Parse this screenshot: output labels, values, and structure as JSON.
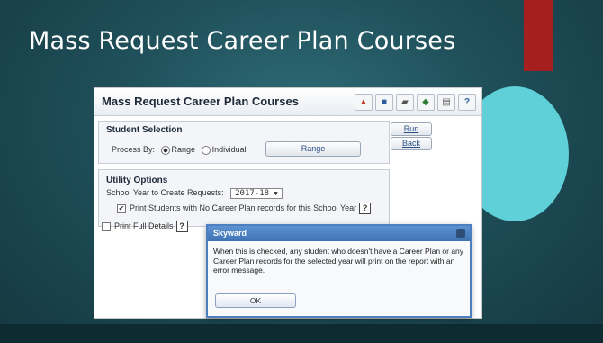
{
  "slide": {
    "title": "Mass Request Career Plan Courses"
  },
  "window": {
    "title": "Mass Request Career Plan Courses",
    "toolbar_icons": [
      "export-icon",
      "document-icon",
      "printer-setup-icon",
      "tag-icon",
      "print-icon",
      "help-icon"
    ],
    "help_symbol": "?"
  },
  "student_selection": {
    "title": "Student Selection",
    "process_by_label": "Process By:",
    "option_range": "Range",
    "option_individual": "Individual",
    "selected": "Range",
    "range_button": "Range"
  },
  "actions": {
    "run": "Run",
    "back": "Back"
  },
  "utility_options": {
    "title": "Utility Options",
    "school_year_label": "School Year to Create Requests:",
    "school_year_value": "2017-18",
    "dropdown_arrow": "▼",
    "print_no_plan_label": "Print Students with No Career Plan records for this School Year",
    "print_no_plan_checked": true,
    "print_full_label": "Print Full Details",
    "print_full_checked": false,
    "help_symbol": "?"
  },
  "dialog": {
    "title": "Skyward",
    "message": "When this is checked, any student who doesn't have a Career Plan or any Career Plan records for the selected year will print on the report with an error message.",
    "ok": "OK"
  },
  "colors": {
    "accent_red": "#a51f1f",
    "circle": "#5fd0d8",
    "dialog_blue": "#4b7fc0"
  }
}
